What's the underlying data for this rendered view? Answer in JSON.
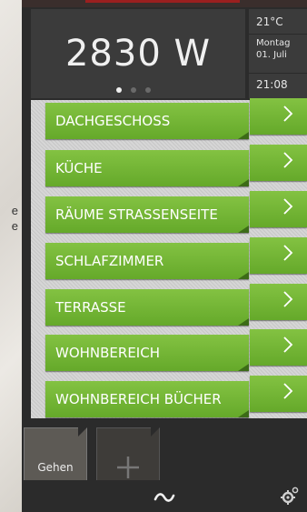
{
  "background": {
    "text_fragments": [
      "e",
      "e"
    ]
  },
  "power": {
    "value": "2830 W"
  },
  "pager": {
    "pages": 3,
    "active": 1
  },
  "info": {
    "temperature": "21°C",
    "weekday": "Montag",
    "date": "01. Juli",
    "time": "21:08"
  },
  "rooms": [
    "DACHGESCHOSS",
    "KÜCHE",
    "RÄUME STRASSENSEITE",
    "SCHLAFZIMMER",
    "TERRASSE",
    "WOHNBEREICH",
    "WOHNBEREICH BÜCHER"
  ],
  "scenes": {
    "gehen_label": "Gehen"
  },
  "icons": {
    "arrow": "chevron-right-icon",
    "add": "plus-icon",
    "wave": "tilde-wave-icon",
    "settings": "gear-icon"
  },
  "colors": {
    "room_green": "#72b533",
    "panel_dark": "#3b3b3b"
  }
}
